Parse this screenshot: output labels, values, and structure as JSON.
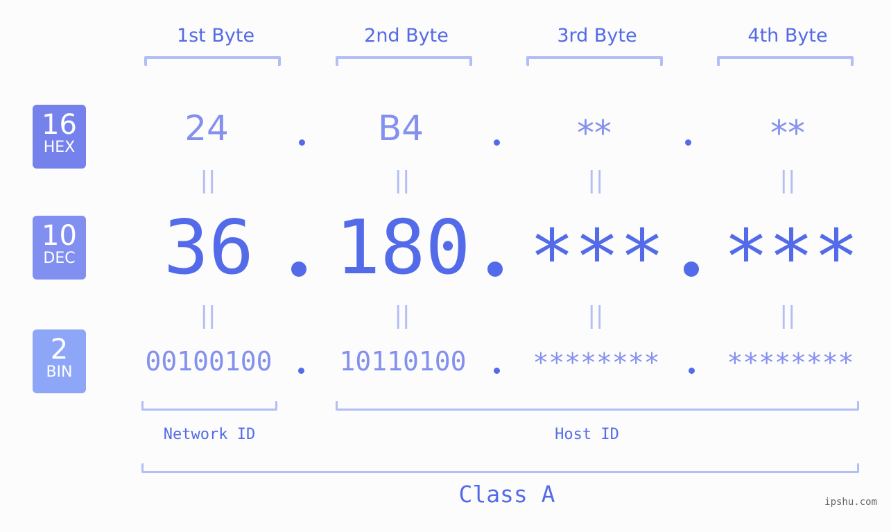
{
  "headers": [
    "1st Byte",
    "2nd Byte",
    "3rd Byte",
    "4th Byte"
  ],
  "bases": [
    {
      "num": "16",
      "label": "HEX",
      "color": "#7582ec"
    },
    {
      "num": "10",
      "label": "DEC",
      "color": "#8190f0"
    },
    {
      "num": "2",
      "label": "BIN",
      "color": "#8da6f8"
    }
  ],
  "hex": [
    "24",
    "B4",
    "**",
    "**"
  ],
  "dec": [
    "36",
    "180",
    "***",
    "***"
  ],
  "bin": [
    "00100100",
    "10110100",
    "********",
    "********"
  ],
  "equals_symbol": "||",
  "network_label": "Network ID",
  "host_label": "Host ID",
  "class_label": "Class A",
  "brand": "ipshu.com",
  "colors": {
    "accent": "#546be9",
    "light": "#8390ee",
    "bracket": "#b3bdf6"
  }
}
